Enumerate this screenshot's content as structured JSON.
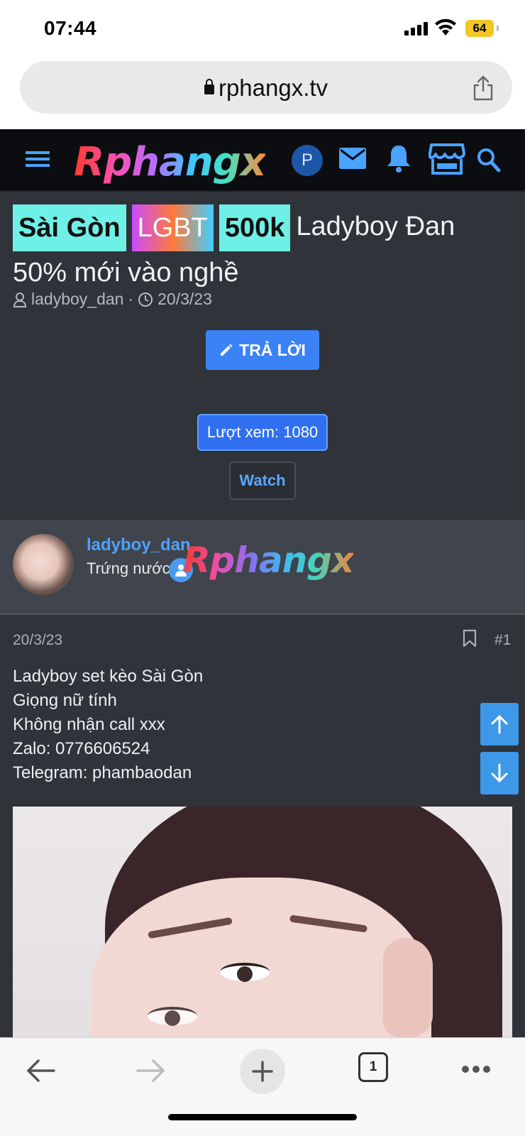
{
  "status_bar": {
    "time": "07:44",
    "battery": "64"
  },
  "browser": {
    "url": "rphangx.tv",
    "tab_count": "1"
  },
  "site": {
    "logo_text": "Rphangx",
    "account_initial": "P"
  },
  "thread": {
    "labels": [
      "Sài Gòn",
      "LGBT",
      "500k"
    ],
    "title": "Ladyboy Đan 50% mới vào nghề",
    "author": "ladyboy_dan",
    "date": "20/3/23",
    "reply_button": "TRẢ LỜI",
    "views_button": "Lượt xem: 1080",
    "watch_button": "Watch"
  },
  "user_card": {
    "username": "ladyboy_dan",
    "user_title": "Trứng nước",
    "watermark": "Rphangx"
  },
  "post": {
    "date": "20/3/23",
    "number": "#1",
    "lines": [
      "Ladyboy set kèo Sài Gòn",
      "Giọng nữ tính",
      "Không nhận call xxx",
      "Zalo: 0776606524",
      "Telegram: phambaodan"
    ]
  },
  "colors": {
    "header_bg": "#0c0d10",
    "content_bg": "#30333a",
    "accent_blue": "#3b82f6",
    "label_cyan": "#6ff0e6",
    "link_blue": "#4aa3ff"
  },
  "icons": {
    "header": [
      "menu-icon",
      "mail-icon",
      "bell-icon",
      "store-icon",
      "search-icon"
    ],
    "toolbar": [
      "back-arrow-icon",
      "forward-arrow-icon",
      "plus-icon",
      "tabs-icon",
      "more-icon"
    ]
  }
}
